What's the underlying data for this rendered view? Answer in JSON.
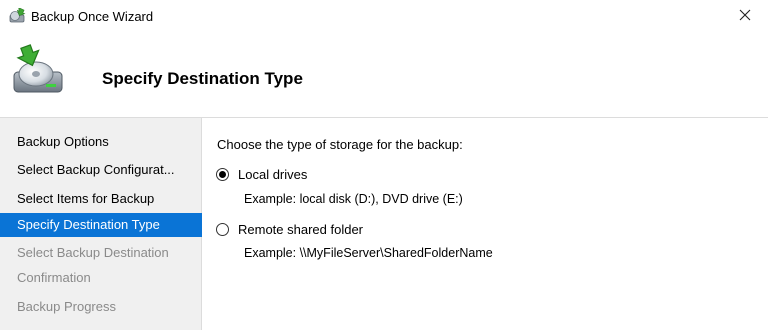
{
  "window": {
    "title": "Backup Once Wizard",
    "close_symbol": "✕"
  },
  "header": {
    "title": "Specify Destination Type",
    "icon": "backup-disk-icon"
  },
  "nav": {
    "items": [
      {
        "label": "Backup Options",
        "state": "normal"
      },
      {
        "label": "Select Backup Configurat...",
        "state": "normal"
      },
      {
        "label": "Select Items for Backup",
        "state": "normal"
      },
      {
        "label": "Specify Destination Type",
        "state": "active"
      },
      {
        "label": "Select Backup Destination",
        "state": "disabled"
      },
      {
        "label": "Confirmation",
        "state": "disabled"
      },
      {
        "label": "Backup Progress",
        "state": "disabled"
      }
    ]
  },
  "main": {
    "prompt": "Choose the type of storage for the backup:",
    "options": [
      {
        "label": "Local drives",
        "example": "Example: local disk (D:), DVD drive (E:)",
        "checked": true
      },
      {
        "label": "Remote shared folder",
        "example": "Example: \\\\MyFileServer\\SharedFolderName",
        "checked": false
      }
    ]
  },
  "colors": {
    "accent": "#0a74d6",
    "nav_bg": "#f0f0f0",
    "disabled_text": "#8a8a8a"
  }
}
